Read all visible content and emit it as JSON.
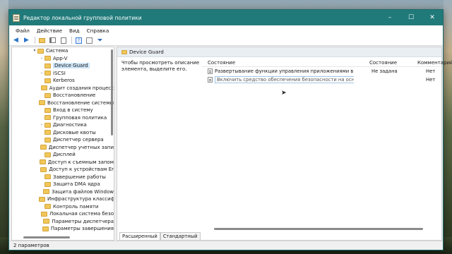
{
  "window": {
    "title": "Редактор локальной групповой политики",
    "minimize": "–",
    "maximize": "☐",
    "close": "✕"
  },
  "menu": [
    "Файл",
    "Действие",
    "Вид",
    "Справка"
  ],
  "toolbar": {
    "icons": [
      "back-icon",
      "forward-icon",
      "folder-up-icon",
      "show-hide-tree-icon",
      "export-list-icon",
      "help-icon",
      "properties-icon",
      "filter-icon"
    ]
  },
  "tree": {
    "items": [
      {
        "label": "Система",
        "twisty": "▾",
        "indent": 1
      },
      {
        "label": "App-V",
        "twisty": "›",
        "indent": 2
      },
      {
        "label": "Device Guard",
        "twisty": "",
        "indent": 2,
        "selected": true
      },
      {
        "label": "iSCSI",
        "twisty": "›",
        "indent": 2
      },
      {
        "label": "Kerberos",
        "twisty": "",
        "indent": 2
      },
      {
        "label": "Аудит создания процесс",
        "twisty": "",
        "indent": 2
      },
      {
        "label": "Восстановление",
        "twisty": "",
        "indent": 2
      },
      {
        "label": "Восстановление системы",
        "twisty": "",
        "indent": 2
      },
      {
        "label": "Вход в систему",
        "twisty": "",
        "indent": 2
      },
      {
        "label": "Групповая политика",
        "twisty": "",
        "indent": 2
      },
      {
        "label": "Диагностика",
        "twisty": "›",
        "indent": 2
      },
      {
        "label": "Дисковые квоты",
        "twisty": "",
        "indent": 2
      },
      {
        "label": "Диспетчер сервера",
        "twisty": "",
        "indent": 2
      },
      {
        "label": "Диспетчер учетных запи",
        "twisty": "",
        "indent": 2
      },
      {
        "label": "Дисплей",
        "twisty": "",
        "indent": 2
      },
      {
        "label": "Доступ к съемным запом",
        "twisty": "",
        "indent": 2
      },
      {
        "label": "Доступ к устройствам Er",
        "twisty": "",
        "indent": 2
      },
      {
        "label": "Завершение работы",
        "twisty": "",
        "indent": 2
      },
      {
        "label": "Защита DMA ядра",
        "twisty": "",
        "indent": 2
      },
      {
        "label": "Защита файлов Window",
        "twisty": "",
        "indent": 2
      },
      {
        "label": "Инфраструктура классиф",
        "twisty": "",
        "indent": 2
      },
      {
        "label": "Контроль памяти",
        "twisty": "",
        "indent": 2
      },
      {
        "label": "Локальная система безо",
        "twisty": "",
        "indent": 2
      },
      {
        "label": "Параметры диспетчера",
        "twisty": "",
        "indent": 2
      },
      {
        "label": "Параметры завершения",
        "twisty": "",
        "indent": 2
      }
    ]
  },
  "right": {
    "header": "Device Guard",
    "description": "Чтобы просмотреть описание элемента, выделите его.",
    "columns": {
      "setting": "Состояние",
      "state": "Состояние",
      "comment": "Комментарий"
    },
    "rows": [
      {
        "setting": "Развертывание функции управления приложениями в За...",
        "state": "Не задана",
        "comment": "Нет"
      },
      {
        "setting": "Включить средство обеспечения безопасности на основе виртуализации",
        "state": "",
        "comment": "Нет"
      }
    ],
    "tabs": [
      "Расширенный",
      "Стандартный"
    ]
  },
  "status": "2 параметров"
}
